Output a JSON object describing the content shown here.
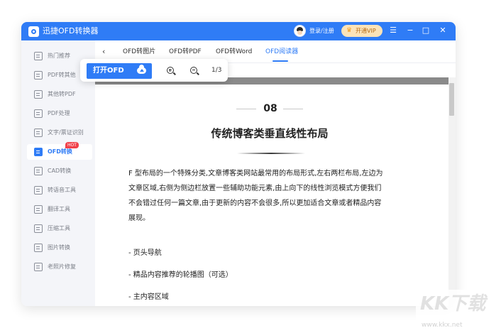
{
  "app": {
    "title": "迅捷OFD转换器"
  },
  "account": {
    "login_label": "登录/注册",
    "vip_label": "开通VIP"
  },
  "window_controls": {
    "menu": "☰",
    "minimize": "−",
    "maximize": "□",
    "close": "✕"
  },
  "sidebar": {
    "items": [
      {
        "label": "热门推荐",
        "icon": "hot-recommend-icon"
      },
      {
        "label": "PDF转其他",
        "icon": "pdf-convert-icon"
      },
      {
        "label": "其他转PDF",
        "icon": "to-pdf-icon"
      },
      {
        "label": "PDF处理",
        "icon": "pdf-process-icon"
      },
      {
        "label": "文字/票证识别",
        "icon": "ocr-icon"
      },
      {
        "label": "OFD转换",
        "icon": "ofd-icon",
        "badge": "HOT",
        "active": true
      },
      {
        "label": "CAD转换",
        "icon": "cad-icon"
      },
      {
        "label": "转语音工具",
        "icon": "voice-icon"
      },
      {
        "label": "翻译工具",
        "icon": "translate-icon"
      },
      {
        "label": "压缩工具",
        "icon": "compress-icon"
      },
      {
        "label": "图片转换",
        "icon": "image-icon"
      },
      {
        "label": "老照片修复",
        "icon": "photo-repair-icon"
      }
    ]
  },
  "tabs": {
    "back_icon": "‹",
    "items": [
      {
        "label": "OFD转图片"
      },
      {
        "label": "OFD转PDF"
      },
      {
        "label": "OFD转Word"
      },
      {
        "label": "OFD阅读器",
        "active": true
      }
    ]
  },
  "toolbar": {
    "open_label": "打开OFD",
    "page_indicator": "1/3"
  },
  "document": {
    "number": "08",
    "heading": "传统博客类垂直线性布局",
    "paragraph_lines": [
      "F 型布局的一个特殊分类,文章博客类网站最常用的布局形式,左右两栏布局,左边为",
      "文章区域,右侧为侧边栏放置一些辅助功能元素,由上向下的线性浏览模式方便我们",
      "不会错过任何一篇文章,由于更新的内容不会很多,所以更加适合文章或者精品内容",
      "展现。"
    ],
    "bullets": [
      "- 页头导航",
      "- 精品内容推荐的轮播图（可选）",
      "- 主内容区域"
    ]
  },
  "watermark": {
    "text": "KK下载",
    "url": "www.kkx.net"
  },
  "colors": {
    "accent": "#2f7cf6",
    "hot_badge": "#f1414a",
    "vip_bg": "#fbe3b8"
  }
}
